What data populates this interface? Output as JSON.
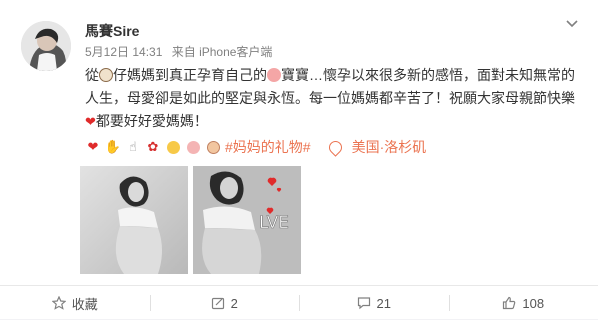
{
  "post": {
    "author": "馬賽Sire",
    "time": "5月12日 14:31",
    "source": "来自 iPhone客户端",
    "line1_a": "從",
    "line1_b": "仔媽媽到真正孕育自己的",
    "line1_c": "寶寶…懷孕以來很多新的感悟，面對未知無常的",
    "line2": "人生，母愛卻是如此的堅定與永恆。每一位媽媽都辛苦了！祝願大家母親節快樂",
    "line3": "都要好好愛媽媽！",
    "hashtag": "#妈妈的礼物#",
    "location": "美国·洛杉矶",
    "love_text": "LVE"
  },
  "footer": {
    "favorite_label": "收藏",
    "repost_count": "2",
    "comment_count": "21",
    "like_count": "108"
  },
  "icons": [
    "chevron-down-icon",
    "heart-icon",
    "pray-icon",
    "hand-icon",
    "rose-icon",
    "smile-icon",
    "pig-icon",
    "baby-icon",
    "location-pin-icon",
    "favorite-icon",
    "repost-icon",
    "comment-icon",
    "like-icon"
  ],
  "colors": {
    "accent": "#eb7350",
    "heart": "#e02b2b"
  }
}
